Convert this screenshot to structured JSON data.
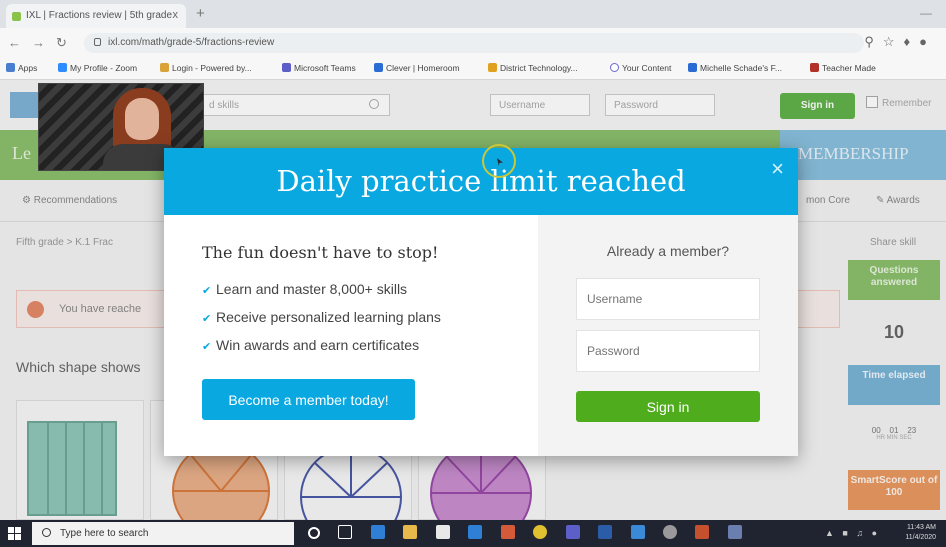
{
  "browser": {
    "tab_title": "IXL | Fractions review | 5th grade",
    "tab_close": "x",
    "new_tab": "+",
    "url": "ixl.com/math/grade-5/fractions-review",
    "bookmarks": [
      "Apps",
      "My Profile - Zoom",
      "Login - Powered by...",
      "Microsoft Teams",
      "Clever | Homeroom",
      "District Technology...",
      "Your Content",
      "Michelle Schade's F...",
      "Teacher Made"
    ]
  },
  "ixl": {
    "search_placeholder": "d skills",
    "username_placeholder": "Username",
    "password_placeholder": "Password",
    "signin_label": "Sign in",
    "remember_label": "Remember",
    "band_text": "Le",
    "membership_label": "MEMBERSHIP",
    "recommendations_label": "Recommendations",
    "common_core_label": "mon Core",
    "awards_label": "Awards",
    "breadcrumb": "Fifth grade  >  K.1 Frac",
    "share_label": "Share skill",
    "banner_text": "You have reache",
    "question_text": "Which shape shows",
    "questions_answered_label": "Questions answered",
    "questions_count": "10",
    "time_elapsed_label": "Time elapsed",
    "timer": {
      "hr": "00",
      "min": "01",
      "sec": "23",
      "units": "HR   MIN   SEC"
    },
    "smartscore_label": "SmartScore out of 100"
  },
  "modal": {
    "title": "Daily practice limit reached",
    "close": "×",
    "headline": "The fun doesn't have to stop!",
    "features": [
      "Learn and master 8,000+ skills",
      "Receive personalized learning plans",
      "Win awards and earn certificates"
    ],
    "become_member": "Become a member today!",
    "already_member": "Already a member?",
    "username_placeholder": "Username",
    "password_placeholder": "Password",
    "signin": "Sign in"
  },
  "taskbar": {
    "search_placeholder": "Type here to search",
    "time": "11:43 AM",
    "date": "11/4/2020"
  },
  "colors": {
    "modal_header": "#0aa8e0",
    "signin_green": "#4fac1c",
    "ixl_green": "#8cc06d"
  }
}
